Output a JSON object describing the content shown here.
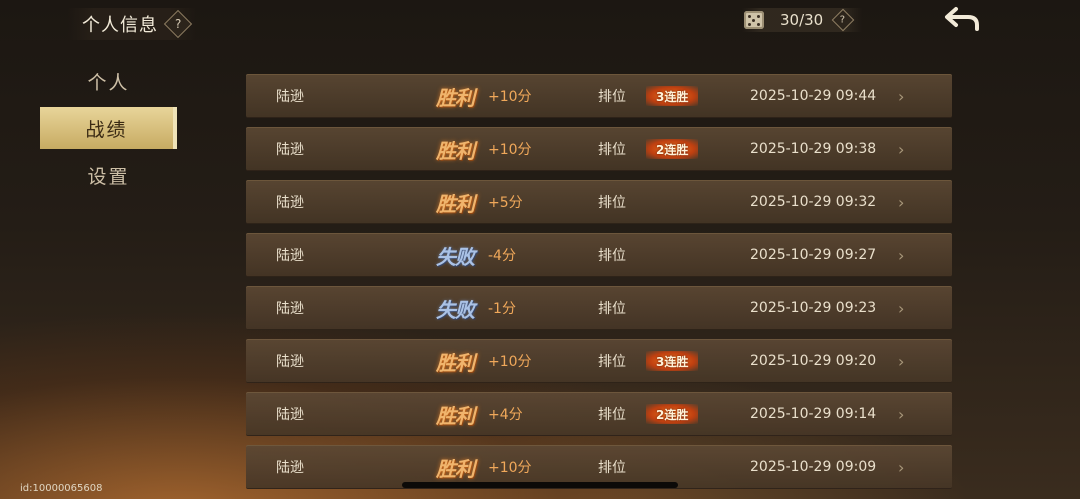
{
  "header": {
    "title": "个人信息",
    "help_label": "?"
  },
  "counter": {
    "value": "30/30",
    "help_label": "?"
  },
  "sidebar": {
    "items": [
      {
        "label": "个人",
        "active": false
      },
      {
        "label": "战绩",
        "active": true
      },
      {
        "label": "设置",
        "active": false
      }
    ]
  },
  "records": [
    {
      "player": "陆逊",
      "result": "胜利",
      "outcome": "win",
      "score": "+10分",
      "mode": "排位",
      "streak": "3连胜",
      "time": "2025-10-29 09:44"
    },
    {
      "player": "陆逊",
      "result": "胜利",
      "outcome": "win",
      "score": "+10分",
      "mode": "排位",
      "streak": "2连胜",
      "time": "2025-10-29 09:38"
    },
    {
      "player": "陆逊",
      "result": "胜利",
      "outcome": "win",
      "score": "+5分",
      "mode": "排位",
      "streak": "",
      "time": "2025-10-29 09:32"
    },
    {
      "player": "陆逊",
      "result": "失败",
      "outcome": "loss",
      "score": "-4分",
      "mode": "排位",
      "streak": "",
      "time": "2025-10-29 09:27"
    },
    {
      "player": "陆逊",
      "result": "失败",
      "outcome": "loss",
      "score": "-1分",
      "mode": "排位",
      "streak": "",
      "time": "2025-10-29 09:23"
    },
    {
      "player": "陆逊",
      "result": "胜利",
      "outcome": "win",
      "score": "+10分",
      "mode": "排位",
      "streak": "3连胜",
      "time": "2025-10-29 09:20"
    },
    {
      "player": "陆逊",
      "result": "胜利",
      "outcome": "win",
      "score": "+4分",
      "mode": "排位",
      "streak": "2连胜",
      "time": "2025-10-29 09:14"
    },
    {
      "player": "陆逊",
      "result": "胜利",
      "outcome": "win",
      "score": "+10分",
      "mode": "排位",
      "streak": "",
      "time": "2025-10-29 09:09"
    }
  ],
  "row_chevron": "›",
  "footer": {
    "uid": "id:10000065608"
  },
  "colors": {
    "win": "#f0b46c",
    "loss": "#aac2e6",
    "score": "#f0a85a",
    "active_tab": "#e8d59a"
  },
  "icons": {
    "back": "back-arrow-icon",
    "dice": "dice-icon",
    "help": "help-icon",
    "chevron": "chevron-right-icon"
  }
}
